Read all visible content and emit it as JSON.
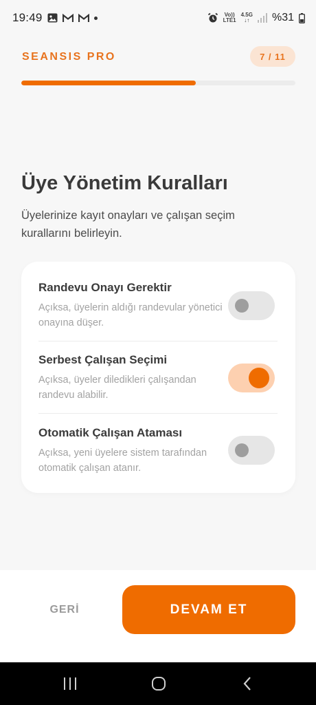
{
  "status_bar": {
    "time": "19:49",
    "network_top": "Vo))",
    "network_bottom": "LTE1",
    "net_speed": "4.5G",
    "battery": "%31",
    "icons": [
      "image-icon",
      "gmail-icon",
      "gmail-icon",
      "dot-icon",
      "alarm-icon",
      "signal-icon",
      "battery-icon"
    ]
  },
  "header": {
    "brand": "SEANSIS PRO",
    "step": "7 / 11",
    "progress_fraction": 0.636,
    "accent_color": "#ef6c00"
  },
  "main": {
    "title": "Üye Yönetim Kuralları",
    "subtitle": "Üyelerinize kayıt onayları ve çalışan seçim kurallarını belirleyin."
  },
  "rules": [
    {
      "title": "Randevu Onayı Gerektir",
      "description": "Açıksa, üyelerin aldığı randevular yönetici onayına düşer.",
      "enabled": false
    },
    {
      "title": "Serbest Çalışan Seçimi",
      "description": "Açıksa, üyeler diledikleri çalışandan randevu alabilir.",
      "enabled": true
    },
    {
      "title": "Otomatik Çalışan Ataması",
      "description": "Açıksa, yeni üyelere sistem tarafından otomatik çalışan atanır.",
      "enabled": false
    }
  ],
  "actions": {
    "back_label": "GERİ",
    "next_label": "DEVAM ET"
  },
  "navbar": {
    "icons": [
      "recent-apps-icon",
      "home-icon",
      "back-icon"
    ]
  }
}
